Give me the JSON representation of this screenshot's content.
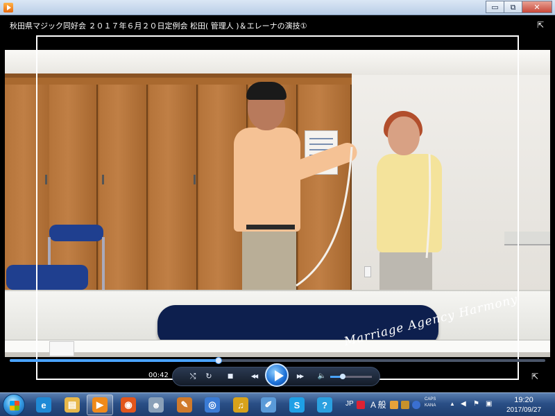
{
  "window": {
    "minimize_glyph": "▭",
    "maximize_glyph": "⧉",
    "close_glyph": "✕"
  },
  "video": {
    "title": "秋田県マジック同好会 ２０１７年６月２０日定例会 松田( 管理人 )＆エレーナの演技①",
    "fullscreen_glyph": "⇱"
  },
  "player": {
    "elapsed_time": "00:42",
    "progress_fraction": 0.39,
    "volume_fraction": 0.3,
    "buttons": {
      "shuffle_glyph": "⤭",
      "repeat_glyph": "↻",
      "stop_glyph": "■",
      "previous_glyph": "◀◀",
      "next_glyph": "▶▶",
      "volume_glyph": "🔈",
      "switch_view_glyph": "⇱"
    }
  },
  "watermark": "Marriage Agency Harmony",
  "taskbar": {
    "apps": [
      {
        "id": "ie",
        "label": "e",
        "color": "#1f8ad6"
      },
      {
        "id": "explorer",
        "label": "▤",
        "color": "#e8b84a"
      },
      {
        "id": "media-player",
        "label": "▶",
        "color": "#f08a1a"
      },
      {
        "id": "firefox",
        "label": "◉",
        "color": "#e2561c"
      },
      {
        "id": "app-5",
        "label": "☻",
        "color": "#8aa0b8"
      },
      {
        "id": "app-6",
        "label": "✎",
        "color": "#d07a2a"
      },
      {
        "id": "app-7",
        "label": "◎",
        "color": "#3a7bd5"
      },
      {
        "id": "app-8",
        "label": "♫",
        "color": "#d8a21a"
      },
      {
        "id": "paint",
        "label": "✐",
        "color": "#5a9ad8"
      },
      {
        "id": "skype",
        "label": "S",
        "color": "#1ea0e6"
      },
      {
        "id": "chat",
        "label": "?",
        "color": "#2aa0e0"
      }
    ],
    "tray": {
      "language": "JP",
      "ime_mode": "A 般",
      "caps": "CAPS",
      "kana": "KANA",
      "time": "19:20",
      "date": "2017/09/27"
    }
  }
}
